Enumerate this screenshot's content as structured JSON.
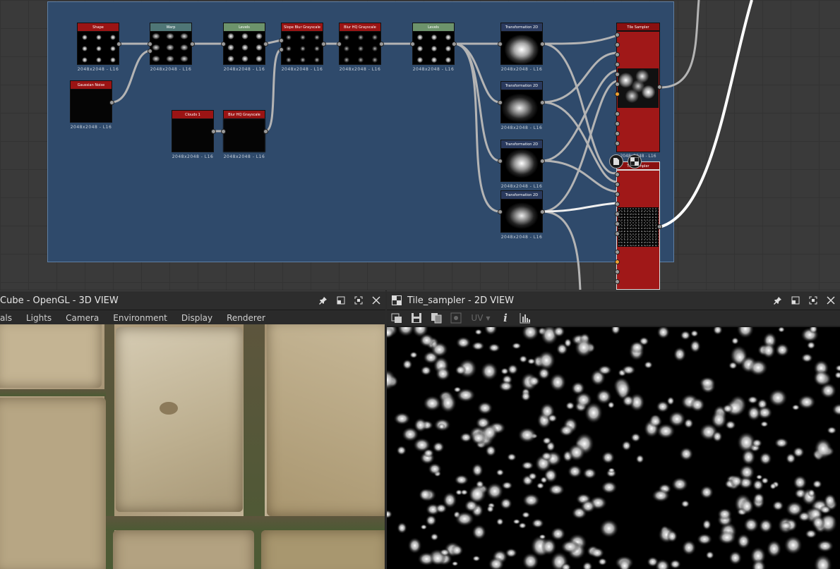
{
  "graph": {
    "nodes": [
      {
        "id": "shape",
        "title": "Shape",
        "caption": "2048x2048 - L16",
        "header": "#9b1414"
      },
      {
        "id": "warp",
        "title": "Warp",
        "caption": "2048x2048 - L16",
        "header": "#4f7676"
      },
      {
        "id": "levels1",
        "title": "Levels",
        "caption": "2048x2048 - L16",
        "header": "#6d936b"
      },
      {
        "id": "slope-blur",
        "title": "Slope Blur Grayscale",
        "caption": "2048x2048 - L16",
        "header": "#9b1414"
      },
      {
        "id": "blur-hq1",
        "title": "Blur HQ Grayscale",
        "caption": "2048x2048 - L16",
        "header": "#9b1414"
      },
      {
        "id": "levels2",
        "title": "Levels",
        "caption": "2048x2048 - L16",
        "header": "#6d936b"
      },
      {
        "id": "gaussian-noise",
        "title": "Gaussian Noise",
        "caption": "2048x2048 - L16",
        "header": "#9b1414"
      },
      {
        "id": "clouds1",
        "title": "Clouds 1",
        "caption": "2048x2048 - L16",
        "header": "#9b1414"
      },
      {
        "id": "blur-hq2",
        "title": "Blur HQ Grayscale",
        "caption": "2048x2048 - L16",
        "header": "#9b1414"
      },
      {
        "id": "transform1",
        "title": "Transformation 2D",
        "caption": "2048x2048 - L16",
        "header": "#2a3a5e"
      },
      {
        "id": "transform2",
        "title": "Transformation 2D",
        "caption": "2048x2048 - L16",
        "header": "#2a3a5e"
      },
      {
        "id": "transform3",
        "title": "Transformation 2D",
        "caption": "2048x2048 - L16",
        "header": "#2a3a5e"
      },
      {
        "id": "transform4",
        "title": "Transformation 2D",
        "caption": "2048x2048 - L16",
        "header": "#2a3a5e"
      }
    ],
    "tile_sampler": {
      "title": "Tile Sampler",
      "caption": "2048x2048 - L16"
    },
    "tile_sampler2": {
      "title": "Tile Sampler"
    }
  },
  "panel3d": {
    "title": "Cube - OpenGL - 3D VIEW",
    "menu": [
      "als",
      "Lights",
      "Camera",
      "Environment",
      "Display",
      "Renderer"
    ]
  },
  "panel2d": {
    "title": "Tile_sampler - 2D VIEW",
    "uv_label": "UV",
    "info_label": "i"
  },
  "icons": {
    "pin": "pin-icon",
    "float": "float-icon",
    "maximize": "maximize-icon",
    "close": "close-icon"
  },
  "colors": {
    "frame": "#2f4a6b",
    "node_red": "#9b1414",
    "accent_orange": "#f0a030"
  }
}
